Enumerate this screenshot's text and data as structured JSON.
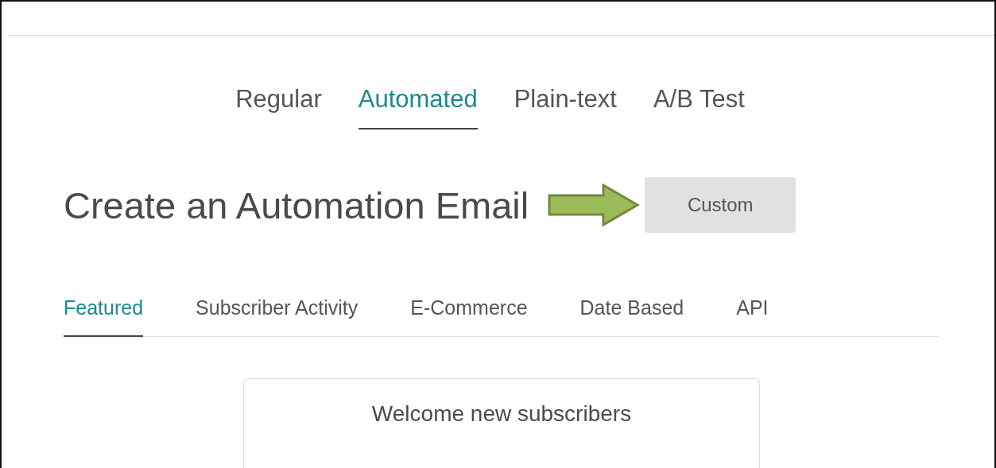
{
  "email_types": [
    {
      "label": "Regular",
      "selected": false
    },
    {
      "label": "Automated",
      "selected": true
    },
    {
      "label": "Plain-text",
      "selected": false
    },
    {
      "label": "A/B Test",
      "selected": false
    }
  ],
  "heading": "Create an Automation Email",
  "custom_button": "Custom",
  "categories": [
    {
      "label": "Featured",
      "selected": true
    },
    {
      "label": "Subscriber Activity",
      "selected": false
    },
    {
      "label": "E-Commerce",
      "selected": false
    },
    {
      "label": "Date Based",
      "selected": false
    },
    {
      "label": "API",
      "selected": false
    }
  ],
  "card": {
    "title": "Welcome new subscribers"
  }
}
